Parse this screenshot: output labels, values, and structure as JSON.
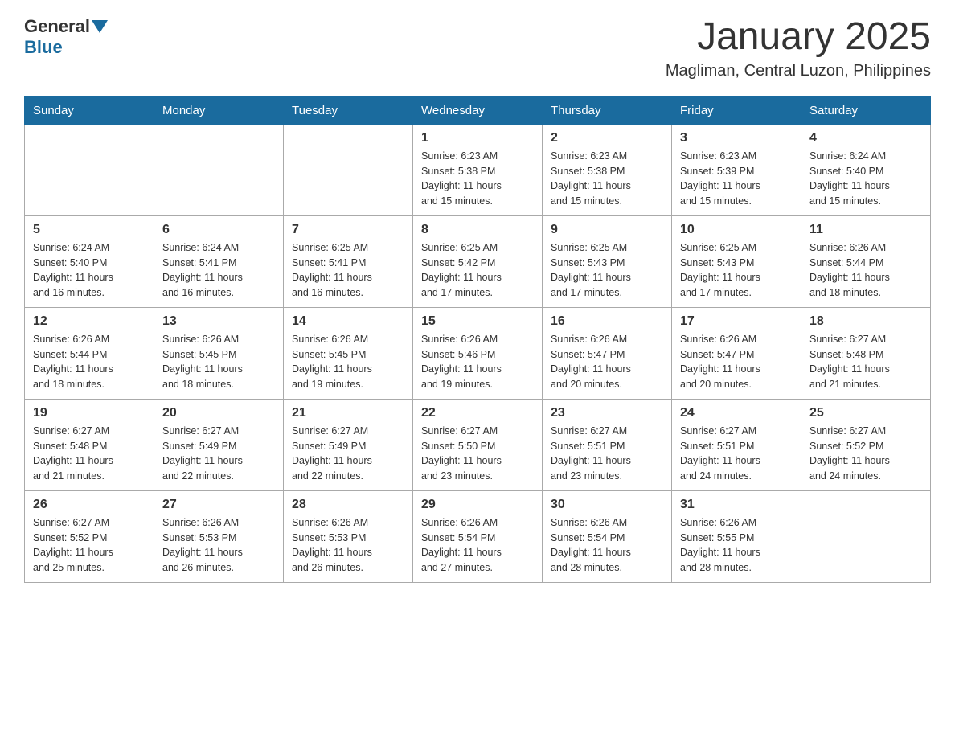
{
  "header": {
    "logo_general": "General",
    "logo_blue": "Blue",
    "month_title": "January 2025",
    "location": "Magliman, Central Luzon, Philippines"
  },
  "weekdays": [
    "Sunday",
    "Monday",
    "Tuesday",
    "Wednesday",
    "Thursday",
    "Friday",
    "Saturday"
  ],
  "weeks": [
    [
      {
        "day": "",
        "info": ""
      },
      {
        "day": "",
        "info": ""
      },
      {
        "day": "",
        "info": ""
      },
      {
        "day": "1",
        "info": "Sunrise: 6:23 AM\nSunset: 5:38 PM\nDaylight: 11 hours\nand 15 minutes."
      },
      {
        "day": "2",
        "info": "Sunrise: 6:23 AM\nSunset: 5:38 PM\nDaylight: 11 hours\nand 15 minutes."
      },
      {
        "day": "3",
        "info": "Sunrise: 6:23 AM\nSunset: 5:39 PM\nDaylight: 11 hours\nand 15 minutes."
      },
      {
        "day": "4",
        "info": "Sunrise: 6:24 AM\nSunset: 5:40 PM\nDaylight: 11 hours\nand 15 minutes."
      }
    ],
    [
      {
        "day": "5",
        "info": "Sunrise: 6:24 AM\nSunset: 5:40 PM\nDaylight: 11 hours\nand 16 minutes."
      },
      {
        "day": "6",
        "info": "Sunrise: 6:24 AM\nSunset: 5:41 PM\nDaylight: 11 hours\nand 16 minutes."
      },
      {
        "day": "7",
        "info": "Sunrise: 6:25 AM\nSunset: 5:41 PM\nDaylight: 11 hours\nand 16 minutes."
      },
      {
        "day": "8",
        "info": "Sunrise: 6:25 AM\nSunset: 5:42 PM\nDaylight: 11 hours\nand 17 minutes."
      },
      {
        "day": "9",
        "info": "Sunrise: 6:25 AM\nSunset: 5:43 PM\nDaylight: 11 hours\nand 17 minutes."
      },
      {
        "day": "10",
        "info": "Sunrise: 6:25 AM\nSunset: 5:43 PM\nDaylight: 11 hours\nand 17 minutes."
      },
      {
        "day": "11",
        "info": "Sunrise: 6:26 AM\nSunset: 5:44 PM\nDaylight: 11 hours\nand 18 minutes."
      }
    ],
    [
      {
        "day": "12",
        "info": "Sunrise: 6:26 AM\nSunset: 5:44 PM\nDaylight: 11 hours\nand 18 minutes."
      },
      {
        "day": "13",
        "info": "Sunrise: 6:26 AM\nSunset: 5:45 PM\nDaylight: 11 hours\nand 18 minutes."
      },
      {
        "day": "14",
        "info": "Sunrise: 6:26 AM\nSunset: 5:45 PM\nDaylight: 11 hours\nand 19 minutes."
      },
      {
        "day": "15",
        "info": "Sunrise: 6:26 AM\nSunset: 5:46 PM\nDaylight: 11 hours\nand 19 minutes."
      },
      {
        "day": "16",
        "info": "Sunrise: 6:26 AM\nSunset: 5:47 PM\nDaylight: 11 hours\nand 20 minutes."
      },
      {
        "day": "17",
        "info": "Sunrise: 6:26 AM\nSunset: 5:47 PM\nDaylight: 11 hours\nand 20 minutes."
      },
      {
        "day": "18",
        "info": "Sunrise: 6:27 AM\nSunset: 5:48 PM\nDaylight: 11 hours\nand 21 minutes."
      }
    ],
    [
      {
        "day": "19",
        "info": "Sunrise: 6:27 AM\nSunset: 5:48 PM\nDaylight: 11 hours\nand 21 minutes."
      },
      {
        "day": "20",
        "info": "Sunrise: 6:27 AM\nSunset: 5:49 PM\nDaylight: 11 hours\nand 22 minutes."
      },
      {
        "day": "21",
        "info": "Sunrise: 6:27 AM\nSunset: 5:49 PM\nDaylight: 11 hours\nand 22 minutes."
      },
      {
        "day": "22",
        "info": "Sunrise: 6:27 AM\nSunset: 5:50 PM\nDaylight: 11 hours\nand 23 minutes."
      },
      {
        "day": "23",
        "info": "Sunrise: 6:27 AM\nSunset: 5:51 PM\nDaylight: 11 hours\nand 23 minutes."
      },
      {
        "day": "24",
        "info": "Sunrise: 6:27 AM\nSunset: 5:51 PM\nDaylight: 11 hours\nand 24 minutes."
      },
      {
        "day": "25",
        "info": "Sunrise: 6:27 AM\nSunset: 5:52 PM\nDaylight: 11 hours\nand 24 minutes."
      }
    ],
    [
      {
        "day": "26",
        "info": "Sunrise: 6:27 AM\nSunset: 5:52 PM\nDaylight: 11 hours\nand 25 minutes."
      },
      {
        "day": "27",
        "info": "Sunrise: 6:26 AM\nSunset: 5:53 PM\nDaylight: 11 hours\nand 26 minutes."
      },
      {
        "day": "28",
        "info": "Sunrise: 6:26 AM\nSunset: 5:53 PM\nDaylight: 11 hours\nand 26 minutes."
      },
      {
        "day": "29",
        "info": "Sunrise: 6:26 AM\nSunset: 5:54 PM\nDaylight: 11 hours\nand 27 minutes."
      },
      {
        "day": "30",
        "info": "Sunrise: 6:26 AM\nSunset: 5:54 PM\nDaylight: 11 hours\nand 28 minutes."
      },
      {
        "day": "31",
        "info": "Sunrise: 6:26 AM\nSunset: 5:55 PM\nDaylight: 11 hours\nand 28 minutes."
      },
      {
        "day": "",
        "info": ""
      }
    ]
  ]
}
